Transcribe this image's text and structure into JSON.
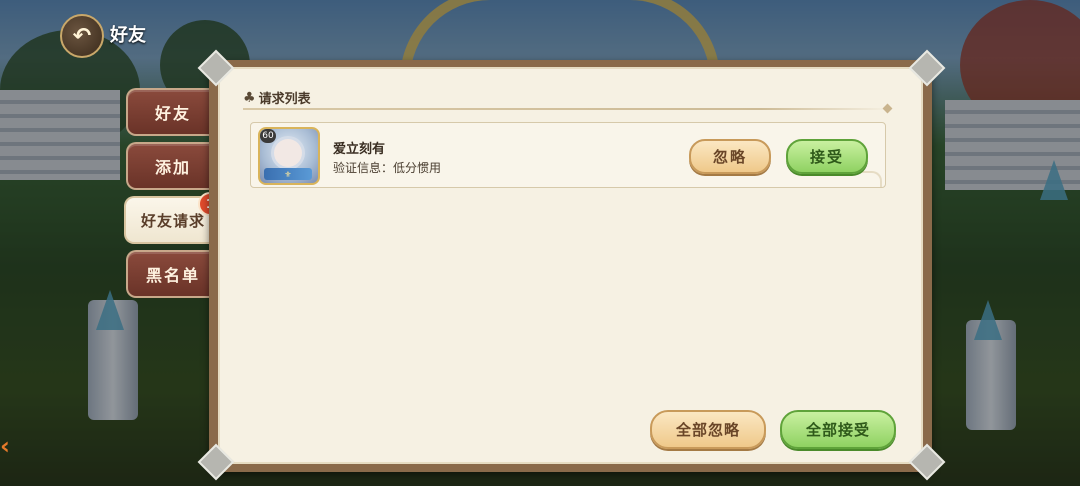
{
  "header": {
    "back_icon": "back-arrow-icon",
    "title": "好友"
  },
  "tabs": [
    {
      "label": "好友",
      "active": false
    },
    {
      "label": "添加",
      "active": false
    },
    {
      "label": "好友请求",
      "active": true,
      "badge": "1"
    },
    {
      "label": "黑名单",
      "active": false
    }
  ],
  "section": {
    "icon": "club-icon",
    "title": "请求列表"
  },
  "requests": [
    {
      "avatar_level": "60",
      "name": "爱立刻有",
      "message": "验证信息：低分惯用",
      "ignore_label": "忽略",
      "accept_label": "接受"
    }
  ],
  "footer": {
    "ignore_all_label": "全部忽略",
    "accept_all_label": "全部接受"
  },
  "colors": {
    "accept_green": "#8fd262",
    "ignore_gold": "#efc98a",
    "badge_red": "#e04a2c"
  }
}
